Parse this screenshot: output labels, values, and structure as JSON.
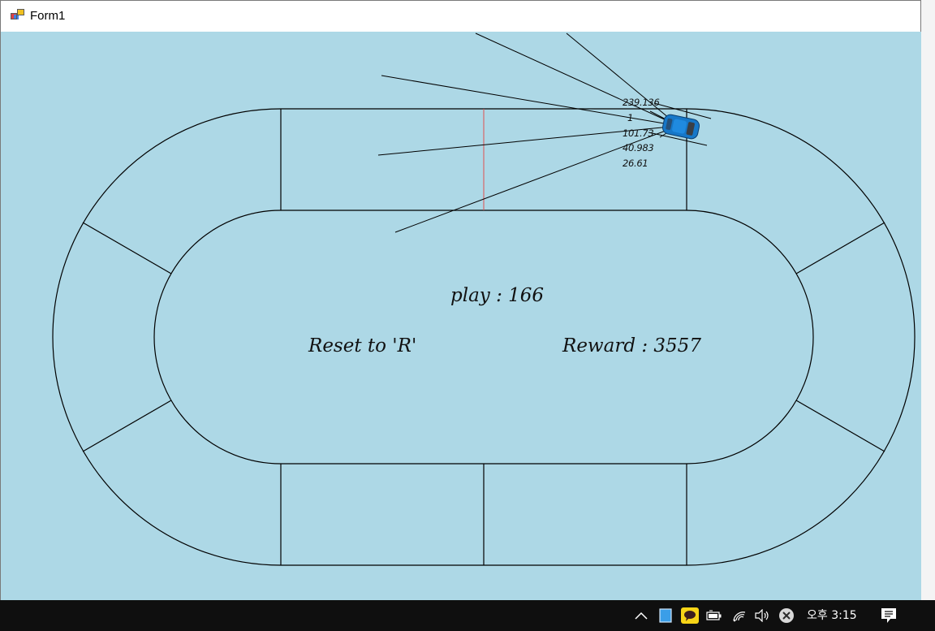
{
  "window": {
    "title": "Form1"
  },
  "hud": {
    "play_label": "play : 166",
    "reset_hint": "Reset to 'R'",
    "reward_label": "Reward : 3557"
  },
  "car": {
    "color": "#1677c8",
    "sensor_readouts": [
      "239.136",
      "1",
      "101.73",
      "40.983",
      "26.61"
    ]
  },
  "colors": {
    "canvas_bg": "#add8e6",
    "track_line": "#000000",
    "checkpoint_line": "#e05050"
  },
  "taskbar": {
    "clock": "오후 3:15",
    "tray_icons": [
      "chevron-up-icon",
      "tablet-icon",
      "kakaotalk-icon",
      "battery-icon",
      "wifi-icon",
      "volume-icon",
      "close-circle-icon",
      "notification-icon"
    ]
  }
}
